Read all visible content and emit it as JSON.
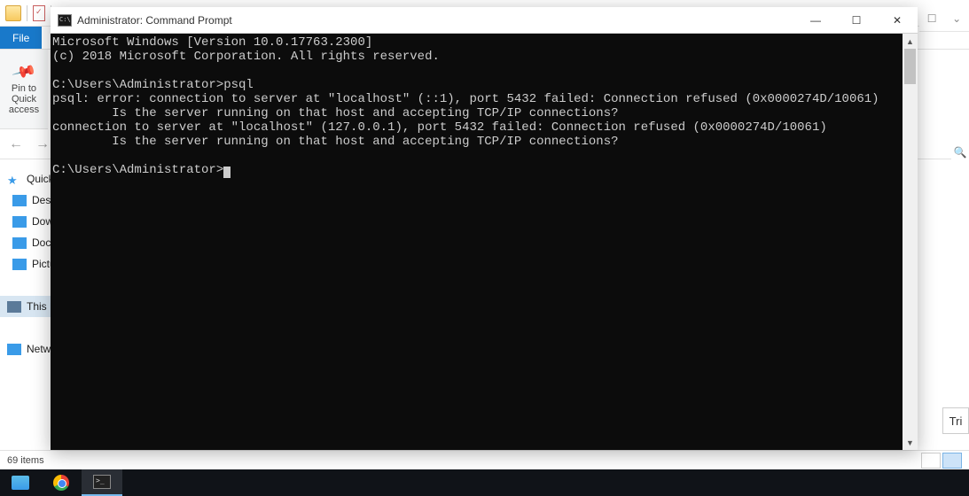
{
  "explorer": {
    "file_tab": "File",
    "qat_pin_label": "Pin to Quick access",
    "sidebar_items": [
      {
        "label": "Quick access",
        "icon": "star"
      },
      {
        "label": "Desktop",
        "icon": "desk"
      },
      {
        "label": "Downloads",
        "icon": "desk"
      },
      {
        "label": "Documents",
        "icon": "doc"
      },
      {
        "label": "Pictures",
        "icon": "pic"
      },
      {
        "label": "This PC",
        "icon": "pc",
        "selected": true
      },
      {
        "label": "Network",
        "icon": "net"
      }
    ],
    "status": "69 items",
    "right_panel": "Tri"
  },
  "cmd": {
    "title": "Administrator: Command Prompt",
    "lines": [
      "Microsoft Windows [Version 10.0.17763.2300]",
      "(c) 2018 Microsoft Corporation. All rights reserved.",
      "",
      "C:\\Users\\Administrator>psql",
      "psql: error: connection to server at \"localhost\" (::1), port 5432 failed: Connection refused (0x0000274D/10061)",
      "        Is the server running on that host and accepting TCP/IP connections?",
      "connection to server at \"localhost\" (127.0.0.1), port 5432 failed: Connection refused (0x0000274D/10061)",
      "        Is the server running on that host and accepting TCP/IP connections?",
      "",
      "C:\\Users\\Administrator>"
    ],
    "min": "—",
    "max": "☐",
    "close": "✕"
  },
  "taskbar": {
    "items": [
      "file-explorer",
      "chrome",
      "cmd"
    ]
  }
}
